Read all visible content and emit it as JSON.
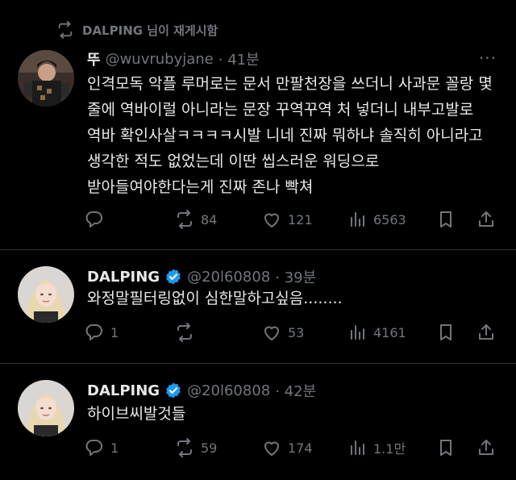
{
  "retweet_banner": {
    "text": "DALPING 님이 재게시함"
  },
  "tweets": [
    {
      "name": "뚜",
      "handle": "@wuvrubyjane",
      "time": "· 41분",
      "more": "···",
      "text": "인격모독 악플 루머로는 문서 만팔천장을 쓰더니 사과문 꼴랑 몇 줄에 역바이럴 아니라는 문장 꾸역꾸역 처 넣더니 내부고발로 역바 확인사살ㅋㅋㅋㅋ시발 니네 진짜 뭐하냐 솔직히 아니라고 생각한 적도 없었는데 이딴 씹스러운 워딩으로 받아들여야한다는게 진짜 존나 빡쳐",
      "stats": {
        "replies": "",
        "reposts": "84",
        "likes": "121",
        "views": "6563"
      }
    },
    {
      "name": "DALPING",
      "handle": "@20l60808",
      "time": "· 39분",
      "text": "와정말필터링없이 심한말하고싶음........",
      "stats": {
        "replies": "1",
        "reposts": "",
        "likes": "53",
        "views": "4161"
      }
    },
    {
      "name": "DALPING",
      "handle": "@20l60808",
      "time": "· 42분",
      "text": "하이브씨발것들",
      "stats": {
        "replies": "1",
        "reposts": "59",
        "likes": "174",
        "views": "1.1만"
      }
    }
  ],
  "icons": [
    "repost-icon",
    "reply-icon",
    "like-icon",
    "views-icon",
    "bookmark-icon",
    "share-icon",
    "verified-badge-icon",
    "more-icon"
  ],
  "colors": {
    "background": "#000000",
    "text": "#e7e9ea",
    "muted": "#71767b",
    "verified": "#1d9bf0",
    "divider": "#2f3336"
  }
}
